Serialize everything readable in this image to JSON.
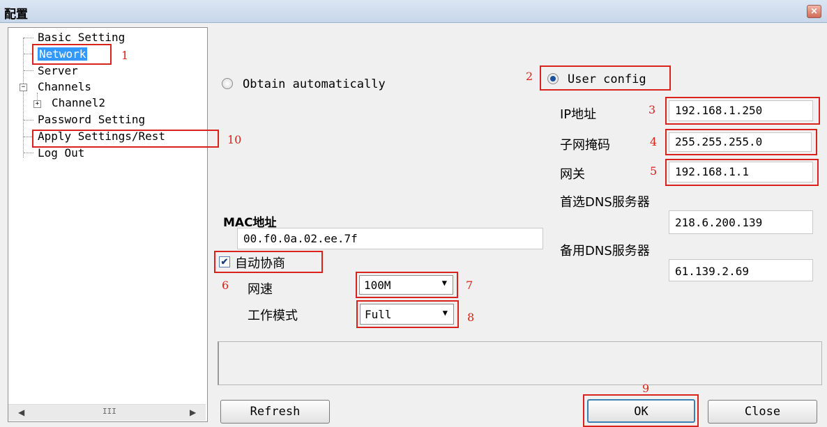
{
  "window": {
    "title": "配置",
    "close_glyph": "✕"
  },
  "tree": {
    "items": [
      {
        "label": "Basic Setting"
      },
      {
        "label": "Network",
        "selected": true
      },
      {
        "label": "Server"
      },
      {
        "label": "Channels",
        "expander": "−"
      },
      {
        "label": "Channel2",
        "expander": "+"
      },
      {
        "label": "Password Setting"
      },
      {
        "label": "Apply Settings/Rest"
      },
      {
        "label": "Log Out"
      }
    ],
    "scroll_left": "◀",
    "scroll_right": "▶",
    "scroll_thumb": "III"
  },
  "annotations": [
    "1",
    "2",
    "3",
    "4",
    "5",
    "6",
    "7",
    "8",
    "9",
    "10"
  ],
  "ip_mode": {
    "auto_label": "Obtain automatically",
    "user_label": "User config",
    "selected": "user"
  },
  "network": {
    "ip_label": "IP地址",
    "ip_value": "192.168.1.250",
    "mask_label": "子网掩码",
    "mask_value": "255.255.255.0",
    "gateway_label": "网关",
    "gateway_value": "192.168.1.1",
    "dns1_label": "首选DNS服务器",
    "dns1_value": "218.6.200.139",
    "dns2_label": "备用DNS服务器",
    "dns2_value": "61.139.2.69"
  },
  "mac": {
    "label": "MAC地址",
    "value": "00.f0.0a.02.ee.7f"
  },
  "auto_negotiate": {
    "label": "自动协商",
    "checked": true,
    "glyph": "✔"
  },
  "speed": {
    "label": "网速",
    "value": "100M",
    "arrow": "▼"
  },
  "mode": {
    "label": "工作模式",
    "value": "Full",
    "arrow": "▼"
  },
  "buttons": {
    "refresh": "Refresh",
    "ok": "OK",
    "close": "Close"
  },
  "colors": {
    "annotation_red": "#d9221b",
    "selection_blue": "#3399ff"
  }
}
